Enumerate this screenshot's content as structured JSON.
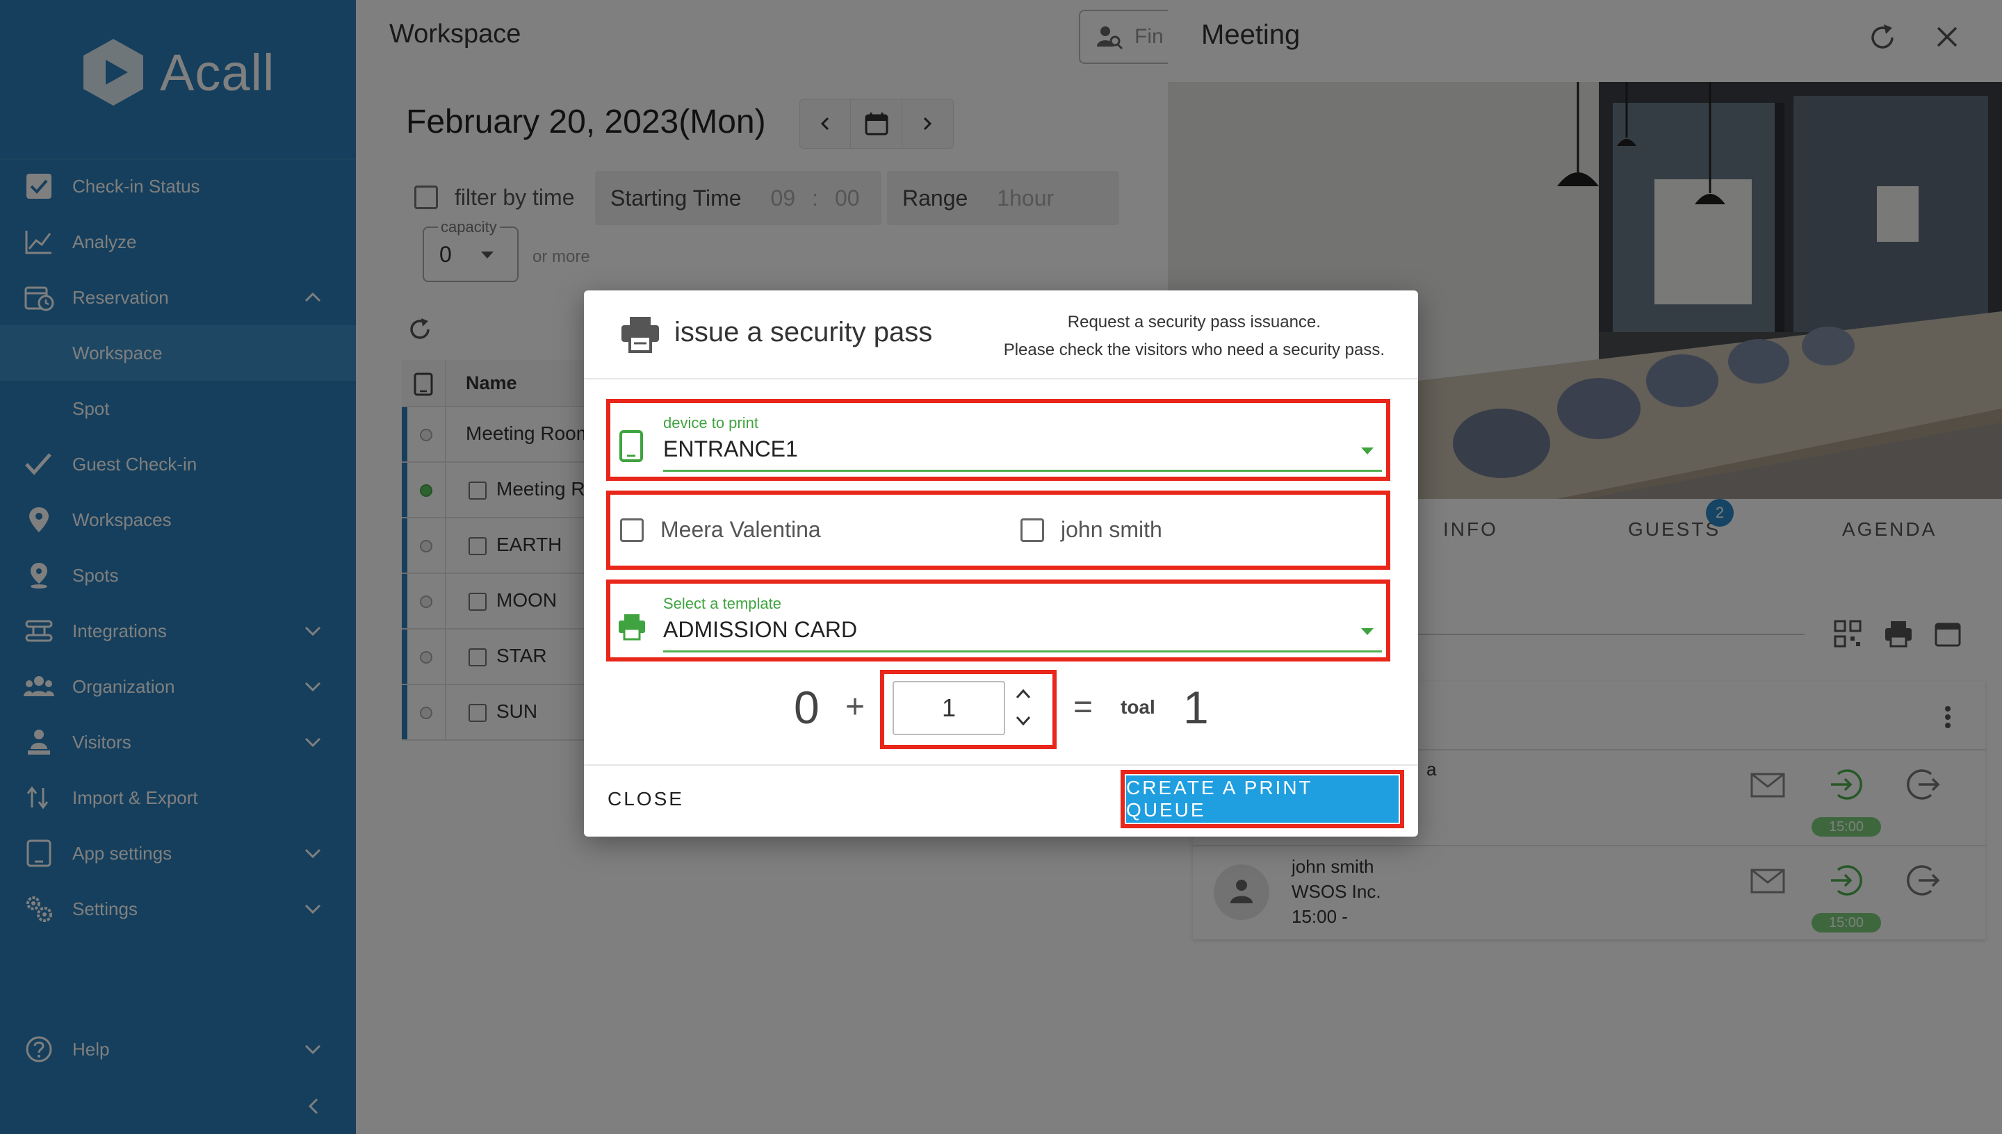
{
  "sidebar": {
    "logo_text": "Acall",
    "items": [
      {
        "label": "Check-in Status"
      },
      {
        "label": "Analyze"
      },
      {
        "label": "Reservation"
      },
      {
        "label": "Workspace"
      },
      {
        "label": "Spot"
      },
      {
        "label": "Guest Check-in"
      },
      {
        "label": "Workspaces"
      },
      {
        "label": "Spots"
      },
      {
        "label": "Integrations"
      },
      {
        "label": "Organization"
      },
      {
        "label": "Visitors"
      },
      {
        "label": "Import & Export"
      },
      {
        "label": "App settings"
      },
      {
        "label": "Settings"
      },
      {
        "label": "Help"
      }
    ]
  },
  "main": {
    "title": "Workspace",
    "find_placeholder": "Fin",
    "date": "February 20, 2023(Mon)",
    "filter_label": "filter by time",
    "starting_time_label": "Starting Time",
    "start_hour": "09",
    "start_sep": ":",
    "start_min": "00",
    "range_label": "Range",
    "range_value": "1hour",
    "capacity_label": "capacity",
    "capacity_value": "0",
    "or_more": "or more",
    "table": {
      "header_name": "Name",
      "rows": [
        {
          "name": "Meeting Room"
        },
        {
          "name": "Meeting Ro"
        },
        {
          "name": "EARTH"
        },
        {
          "name": "MOON"
        },
        {
          "name": "STAR"
        },
        {
          "name": "SUN"
        }
      ]
    }
  },
  "right_panel": {
    "title": "Meeting",
    "tabs": [
      {
        "label": "INFO"
      },
      {
        "label": "GUESTS"
      },
      {
        "label": "AGENDA"
      }
    ],
    "guests_badge": "2",
    "guests": [
      {
        "name_partial": "a",
        "time_pill": "15:00"
      },
      {
        "name": "john smith",
        "company": "WSOS Inc.",
        "time": "15:00  -",
        "time_pill": "15:00"
      }
    ]
  },
  "dialog": {
    "title": "issue a security pass",
    "desc_line1": "Request a security pass issuance.",
    "desc_line2": "Please check the visitors who need a security pass.",
    "device_label": "device to print",
    "device_value": "ENTRANCE1",
    "visitors": [
      {
        "name": "Meera Valentina"
      },
      {
        "name": "john smith"
      }
    ],
    "template_label": "Select a template",
    "template_value": "ADMISSION CARD",
    "count_base": "0",
    "plus": "+",
    "count_input": "1",
    "equals": "=",
    "total_label": "toal",
    "total_value": "1",
    "close_label": "CLOSE",
    "create_label": "CREATE A PRINT QUEUE"
  },
  "colors": {
    "sidebar": "#2b7fb8",
    "accent_green": "#4fb04f",
    "highlight_red": "#e8261a",
    "primary_button": "#1f9ee0"
  }
}
